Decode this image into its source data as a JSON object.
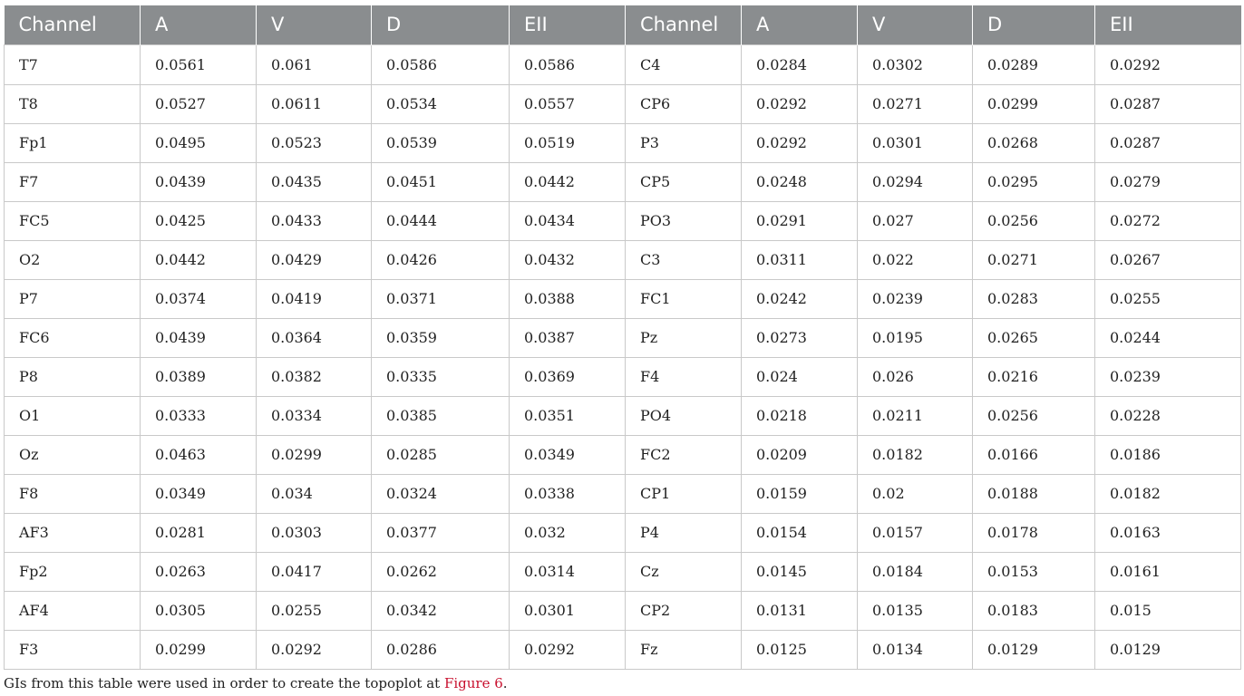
{
  "table": {
    "headers": [
      "Channel",
      "A",
      "V",
      "D",
      "EII",
      "Channel",
      "A",
      "V",
      "D",
      "EII"
    ],
    "rows": [
      [
        "T7",
        "0.0561",
        "0.061",
        "0.0586",
        "0.0586",
        "C4",
        "0.0284",
        "0.0302",
        "0.0289",
        "0.0292"
      ],
      [
        "T8",
        "0.0527",
        "0.0611",
        "0.0534",
        "0.0557",
        "CP6",
        "0.0292",
        "0.0271",
        "0.0299",
        "0.0287"
      ],
      [
        "Fp1",
        "0.0495",
        "0.0523",
        "0.0539",
        "0.0519",
        "P3",
        "0.0292",
        "0.0301",
        "0.0268",
        "0.0287"
      ],
      [
        "F7",
        "0.0439",
        "0.0435",
        "0.0451",
        "0.0442",
        "CP5",
        "0.0248",
        "0.0294",
        "0.0295",
        "0.0279"
      ],
      [
        "FC5",
        "0.0425",
        "0.0433",
        "0.0444",
        "0.0434",
        "PO3",
        "0.0291",
        "0.027",
        "0.0256",
        "0.0272"
      ],
      [
        "O2",
        "0.0442",
        "0.0429",
        "0.0426",
        "0.0432",
        "C3",
        "0.0311",
        "0.022",
        "0.0271",
        "0.0267"
      ],
      [
        "P7",
        "0.0374",
        "0.0419",
        "0.0371",
        "0.0388",
        "FC1",
        "0.0242",
        "0.0239",
        "0.0283",
        "0.0255"
      ],
      [
        "FC6",
        "0.0439",
        "0.0364",
        "0.0359",
        "0.0387",
        "Pz",
        "0.0273",
        "0.0195",
        "0.0265",
        "0.0244"
      ],
      [
        "P8",
        "0.0389",
        "0.0382",
        "0.0335",
        "0.0369",
        "F4",
        "0.024",
        "0.026",
        "0.0216",
        "0.0239"
      ],
      [
        "O1",
        "0.0333",
        "0.0334",
        "0.0385",
        "0.0351",
        "PO4",
        "0.0218",
        "0.0211",
        "0.0256",
        "0.0228"
      ],
      [
        "Oz",
        "0.0463",
        "0.0299",
        "0.0285",
        "0.0349",
        "FC2",
        "0.0209",
        "0.0182",
        "0.0166",
        "0.0186"
      ],
      [
        "F8",
        "0.0349",
        "0.034",
        "0.0324",
        "0.0338",
        "CP1",
        "0.0159",
        "0.02",
        "0.0188",
        "0.0182"
      ],
      [
        "AF3",
        "0.0281",
        "0.0303",
        "0.0377",
        "0.032",
        "P4",
        "0.0154",
        "0.0157",
        "0.0178",
        "0.0163"
      ],
      [
        "Fp2",
        "0.0263",
        "0.0417",
        "0.0262",
        "0.0314",
        "Cz",
        "0.0145",
        "0.0184",
        "0.0153",
        "0.0161"
      ],
      [
        "AF4",
        "0.0305",
        "0.0255",
        "0.0342",
        "0.0301",
        "CP2",
        "0.0131",
        "0.0135",
        "0.0183",
        "0.015"
      ],
      [
        "F3",
        "0.0299",
        "0.0292",
        "0.0286",
        "0.0292",
        "Fz",
        "0.0125",
        "0.0134",
        "0.0129",
        "0.0129"
      ]
    ]
  },
  "footnote": {
    "text_before": "GIs from this table were used in order to create the topoplot at ",
    "link_text": "Figure 6",
    "text_after": "."
  }
}
